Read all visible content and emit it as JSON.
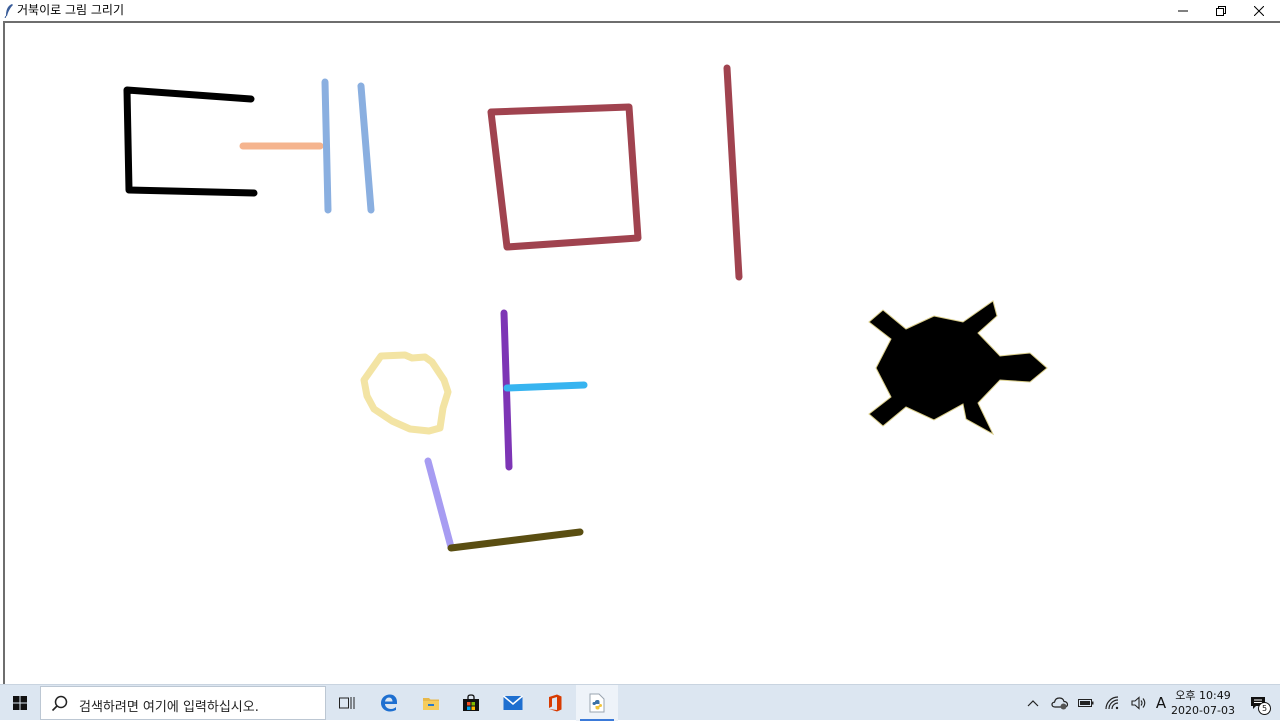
{
  "window": {
    "title": "거북이로 그림 그리기"
  },
  "canvas": {
    "background": "#ffffff",
    "strokes": [
      {
        "name": "black-bracket",
        "color": "#000000"
      },
      {
        "name": "peach-line",
        "color": "#f5b48e"
      },
      {
        "name": "blue-line-1",
        "color": "#8aafe0"
      },
      {
        "name": "blue-line-2",
        "color": "#8aafe0"
      },
      {
        "name": "maroon-square",
        "color": "#a0434f"
      },
      {
        "name": "maroon-line",
        "color": "#a0434f"
      },
      {
        "name": "yellow-blob",
        "color": "#f3e4a4"
      },
      {
        "name": "purple-line",
        "color": "#7d35b5"
      },
      {
        "name": "cyan-line",
        "color": "#37b4f0"
      },
      {
        "name": "lavender-line",
        "color": "#a79cf2"
      },
      {
        "name": "olive-line",
        "color": "#5a4e12"
      }
    ],
    "turtle": {
      "color": "#000000",
      "outline": "#d8cc88",
      "icon": "turtle-icon"
    }
  },
  "taskbar": {
    "search_placeholder": "검색하려면 여기에 입력하십시오.",
    "apps": [
      {
        "name": "task-view-icon"
      },
      {
        "name": "edge-icon"
      },
      {
        "name": "file-explorer-icon"
      },
      {
        "name": "store-icon"
      },
      {
        "name": "mail-icon"
      },
      {
        "name": "office-icon"
      },
      {
        "name": "python-turtle-icon"
      }
    ],
    "ime": "A",
    "clock": {
      "time": "오후 10:49",
      "date": "2020-07-03"
    },
    "notification_count": "5",
    "accent": "#3b7ad9"
  }
}
